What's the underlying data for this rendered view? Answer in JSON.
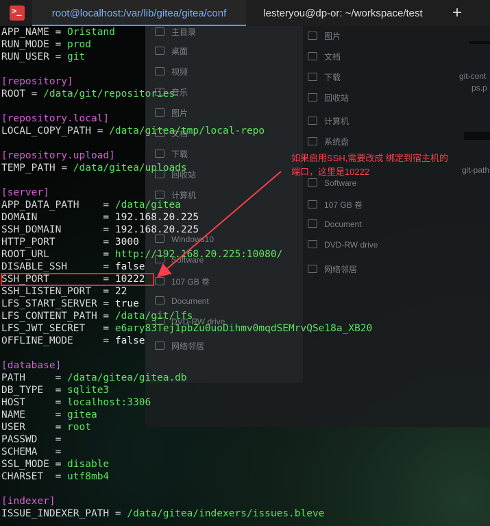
{
  "tabs": [
    {
      "label": "root@localhost:/var/lib/gitea/gitea/conf",
      "active": true
    },
    {
      "label": "lesteryou@dp-or: ~/workspace/test",
      "active": false
    }
  ],
  "app_icon": {
    "glyph": ">_",
    "name": "terminal-icon"
  },
  "add_tab_glyph": "+",
  "annotation": {
    "text": "如果启用SSH,需要改成 绑定到宿主机的端口，这里是10222",
    "color": "#ff3d4a"
  },
  "background_file_manager": {
    "sidebar": [
      "主目录",
      "桌面",
      "视频",
      "音乐",
      "图片",
      "文档",
      "下载",
      "回收站",
      "计算机",
      "Windows10",
      "Software",
      "107 GB 卷",
      "Document",
      "DVD-RW drive",
      "网络邻居"
    ],
    "main": [
      "图片",
      "文档",
      "下载",
      "回收站",
      "计算机",
      "系统盘",
      "Software",
      "107 GB 卷",
      "Document",
      "DVD-RW drive",
      "网络邻居"
    ],
    "files": [
      "git-cont",
      "ps.p",
      "git-path"
    ]
  },
  "config": [
    {
      "type": "kv",
      "key": "APP_NAME ",
      "value": "Oristand"
    },
    {
      "type": "kv",
      "key": "RUN_MODE ",
      "value": "prod"
    },
    {
      "type": "kv",
      "key": "RUN_USER ",
      "value": "git"
    },
    {
      "type": "blank"
    },
    {
      "type": "section",
      "text": "[repository]"
    },
    {
      "type": "kv",
      "key": "ROOT ",
      "value": "/data/git/repositories"
    },
    {
      "type": "blank"
    },
    {
      "type": "section",
      "text": "[repository.local]"
    },
    {
      "type": "kv",
      "key": "LOCAL_COPY_PATH ",
      "value": "/data/gitea/tmp/local-repo"
    },
    {
      "type": "blank"
    },
    {
      "type": "section",
      "text": "[repository.upload]"
    },
    {
      "type": "kv",
      "key": "TEMP_PATH ",
      "value": "/data/gitea/uploads"
    },
    {
      "type": "blank"
    },
    {
      "type": "section",
      "text": "[server]"
    },
    {
      "type": "kv",
      "key": "APP_DATA_PATH    ",
      "value": "/data/gitea"
    },
    {
      "type": "kv",
      "key": "DOMAIN           ",
      "value": "192.168.20.225",
      "white": true
    },
    {
      "type": "kv",
      "key": "SSH_DOMAIN       ",
      "value": "192.168.20.225",
      "white": true
    },
    {
      "type": "kv",
      "key": "HTTP_PORT        ",
      "value": "3000",
      "white": true
    },
    {
      "type": "kv",
      "key": "ROOT_URL         ",
      "value": "http://192.168.20.225:10080/",
      "mixed": true
    },
    {
      "type": "kv",
      "key": "DISABLE_SSH      ",
      "value": "false",
      "white": true
    },
    {
      "type": "kv",
      "key": "SSH_PORT         ",
      "value": "10222",
      "white": true
    },
    {
      "type": "kv",
      "key": "SSH_LISTEN_PORT  ",
      "value": "22",
      "white": true
    },
    {
      "type": "kv",
      "key": "LFS_START_SERVER ",
      "value": "true",
      "white": true
    },
    {
      "type": "kv",
      "key": "LFS_CONTENT_PATH ",
      "value": "/data/git/lfs"
    },
    {
      "type": "kv",
      "key": "LFS_JWT_SECRET   ",
      "value": "e6ary83Tej1pbZu0uoDihmv0mqdSEMrvQSe18a_XB20"
    },
    {
      "type": "kv",
      "key": "OFFLINE_MODE     ",
      "value": "false",
      "white": true
    },
    {
      "type": "blank"
    },
    {
      "type": "section",
      "text": "[database]"
    },
    {
      "type": "kv",
      "key": "PATH     ",
      "value": "/data/gitea/gitea.db"
    },
    {
      "type": "kv",
      "key": "DB_TYPE  ",
      "value": "sqlite3"
    },
    {
      "type": "kv",
      "key": "HOST     ",
      "value": "localhost:3306",
      "mixed_host": true
    },
    {
      "type": "kv",
      "key": "NAME     ",
      "value": "gitea"
    },
    {
      "type": "kv",
      "key": "USER     ",
      "value": "root"
    },
    {
      "type": "kv",
      "key": "PASSWD   ",
      "value": ""
    },
    {
      "type": "kv",
      "key": "SCHEMA   ",
      "value": ""
    },
    {
      "type": "kv",
      "key": "SSL_MODE ",
      "value": "disable"
    },
    {
      "type": "kv",
      "key": "CHARSET  ",
      "value": "utf8mb4"
    },
    {
      "type": "blank"
    },
    {
      "type": "section",
      "text": "[indexer]"
    },
    {
      "type": "kv",
      "key": "ISSUE_INDEXER_PATH ",
      "value": "/data/gitea/indexers/issues.bleve"
    }
  ],
  "colors": {
    "key": "#d8d8d8",
    "string_value": "#5de35d",
    "section": "#d85cd8",
    "highlight_box": "#e8283c",
    "active_tab_text": "#6fb0ff"
  }
}
